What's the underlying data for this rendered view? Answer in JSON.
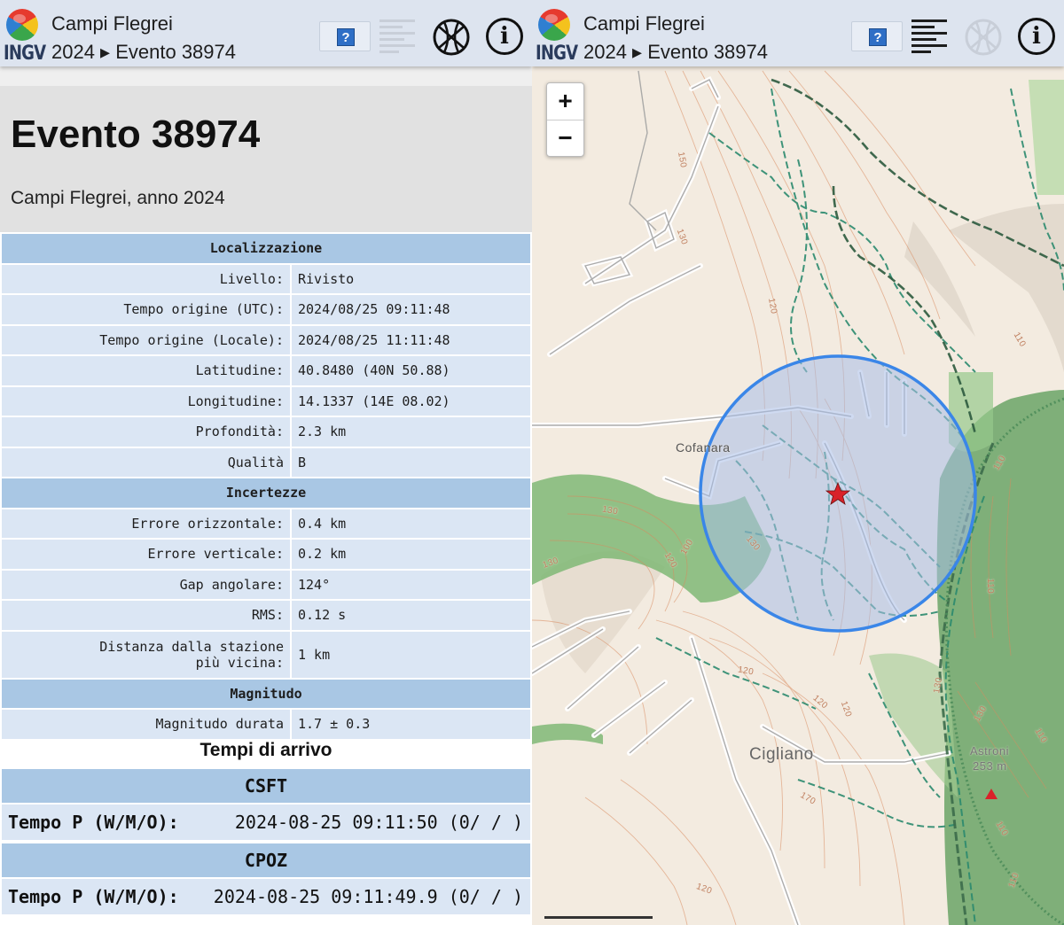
{
  "app": {
    "logo_text": "INGV",
    "title": "Campi Flegrei",
    "breadcrumb": "2024 ▸ Evento 38974",
    "help_label": "?",
    "info_label": "i"
  },
  "event": {
    "heading": "Evento 38974",
    "subtitle": "Campi Flegrei, anno 2024"
  },
  "sections": {
    "localizzazione": "Localizzazione",
    "incertezze": "Incertezze",
    "magnitudo": "Magnitudo"
  },
  "rows": {
    "livello": {
      "label": "Livello:",
      "value": "Rivisto"
    },
    "tempo_utc": {
      "label": "Tempo origine (UTC):",
      "value": "2024/08/25 09:11:48"
    },
    "tempo_locale": {
      "label": "Tempo origine (Locale):",
      "value": "2024/08/25 11:11:48"
    },
    "latitudine": {
      "label": "Latitudine:",
      "value": "40.8480 (40N 50.88)"
    },
    "longitudine": {
      "label": "Longitudine:",
      "value": "14.1337 (14E 08.02)"
    },
    "profondita": {
      "label": "Profondità:",
      "value": "2.3 km"
    },
    "qualita": {
      "label": "Qualità",
      "value": "B"
    },
    "err_orizz": {
      "label": "Errore orizzontale:",
      "value": "0.4 km"
    },
    "err_vert": {
      "label": "Errore verticale:",
      "value": "0.2 km"
    },
    "gap": {
      "label": "Gap angolare:",
      "value": "124°"
    },
    "rms": {
      "label": "RMS:",
      "value": "0.12 s"
    },
    "distanza": {
      "label_line1": "Distanza dalla stazione",
      "label_line2": "più vicina:",
      "value": "1 km"
    },
    "magnitudo_durata": {
      "label": "Magnitudo durata",
      "value": "1.7 ± 0.3"
    }
  },
  "arrivals": {
    "title": "Tempi di arrivo",
    "stations": [
      {
        "name": "CSFT",
        "label": "Tempo P (W/M/O):",
        "value": "2024-08-25 09:11:50 (0/ / )"
      },
      {
        "name": "CPOZ",
        "label": "Tempo P (W/M/O):",
        "value": "2024-08-25 09:11:49.9 (0/ / )"
      }
    ]
  },
  "map": {
    "zoom_in": "+",
    "zoom_out": "−",
    "labels": {
      "cofanara": "Cofanara",
      "cigliano": "Cigliano",
      "astroni": "Astroni",
      "astroni_elev": "253 m"
    },
    "contours": [
      "130",
      "120",
      "110",
      "110",
      "110",
      "120",
      "130",
      "130",
      "120",
      "120",
      "120",
      "130",
      "150",
      "110",
      "130",
      "110",
      "170",
      "120",
      "100",
      "110",
      "130"
    ],
    "colors": {
      "circle_stroke": "#3a86e8",
      "circle_fill": "#a8bde8",
      "epicenter": "#d9222a",
      "vegetation": "#7fb875",
      "path": "#2b8a6e"
    }
  }
}
